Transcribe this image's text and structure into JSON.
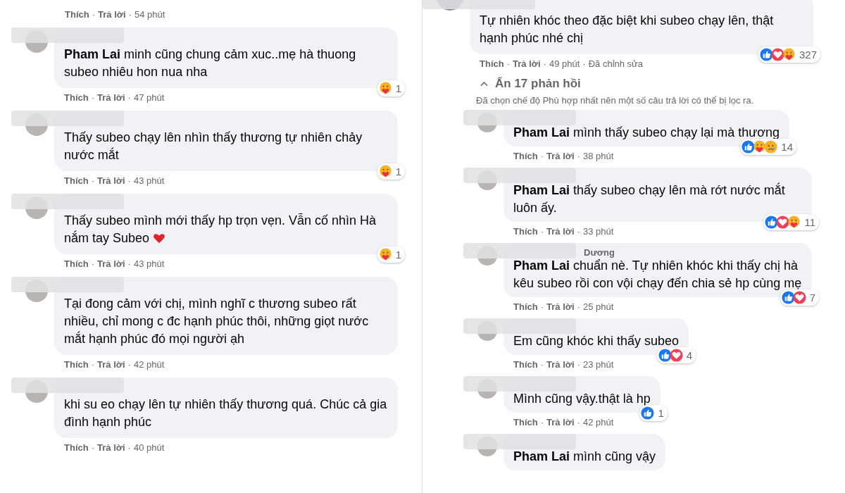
{
  "left_column": {
    "top_meta": {
      "actions": [
        "Thích",
        "Trả lời"
      ],
      "separator": "·",
      "time": "54 phút"
    },
    "comments": [
      {
        "name_blurred": true,
        "text": "**Pham Lai** minh cũng chung cảm xuc..mẹ hà thuong subeo nhiêu hon nua nha",
        "reactions": {
          "icons": [
            {
              "kind": "care"
            }
          ],
          "count": "1"
        },
        "meta": {
          "actions": [
            "Thích",
            "Trả lời"
          ],
          "separator": "·",
          "time": "47 phút"
        }
      },
      {
        "name_blurred": true,
        "text": "Thấy subeo chạy lên nhìn thấy thương tự nhiên chảy nước mắt",
        "reactions": {
          "icons": [
            {
              "kind": "care"
            }
          ],
          "count": "1"
        },
        "meta": {
          "actions": [
            "Thích",
            "Trả lời"
          ],
          "separator": "·",
          "time": "43 phút"
        }
      },
      {
        "name_blurred": true,
        "text": "Thấy subeo mình mới thấy hp trọn vẹn. Vẫn cố nhìn Hà nắm tay Subeo",
        "emoji": {
          "kind": "heart"
        },
        "reactions": {
          "icons": [
            {
              "kind": "care"
            }
          ],
          "count": "1"
        },
        "meta": {
          "actions": [
            "Thích",
            "Trả lời"
          ],
          "separator": "·",
          "time": "43 phút"
        }
      },
      {
        "name_blurred": true,
        "text": "Tại đong cảm với chị, mình nghĩ c thương subeo rất nhiều, chỉ mong c đc hạnh phúc thôi, những giọt nước mắt hạnh phúc đó mọi người ạh",
        "meta": {
          "actions": [
            "Thích",
            "Trả lời"
          ],
          "separator": "·",
          "time": "42 phút"
        }
      },
      {
        "name_blurred": true,
        "text": "khi su eo chạy lên tự nhiên thấy thương quá. Chúc cả gia đình hạnh phúc",
        "meta": {
          "actions": [
            "Thích",
            "Trả lời"
          ],
          "separator": "·",
          "time": "40 phút"
        }
      }
    ]
  },
  "right_column": {
    "comment": {
      "name_blurred": true,
      "text": "Tự nhiên khóc theo đặc biệt khi subeo chạy lên, thật hạnh phúc nhé chị",
      "reactions": {
        "icons": [
          {
            "kind": "like"
          },
          {
            "kind": "love"
          },
          {
            "kind": "care"
          }
        ],
        "count": "327"
      },
      "meta": {
        "actions": [
          "Thích",
          "Trả lời"
        ],
        "separator": "·",
        "time": "49 phút",
        "edited": "Đã chỉnh sửa"
      }
    },
    "replies_toggle": {
      "label": "Ẩn 17 phản hồi",
      "expanded": true
    },
    "filter_note": "Đã chọn chế độ Phù hợp nhất nên một số câu trả lời có thể bị lọc ra.",
    "replies": [
      {
        "name_blurred": true,
        "text": "**Pham Lai** mình thấy subeo chạy lại mà thương",
        "reactions": {
          "icons": [
            {
              "kind": "like"
            },
            {
              "kind": "care"
            },
            {
              "kind": "sad"
            }
          ],
          "count": "14"
        },
        "meta": {
          "actions": [
            "Thích",
            "Trả lời"
          ],
          "separator": "·",
          "time": "38 phút"
        }
      },
      {
        "name_blurred": true,
        "text": "**Pham Lai** thấy subeo chạy lên mà rớt nước mắt luôn ấy.",
        "reactions": {
          "icons": [
            {
              "kind": "like"
            },
            {
              "kind": "love"
            },
            {
              "kind": "care"
            }
          ],
          "count": "11"
        },
        "meta": {
          "actions": [
            "Thích",
            "Trả lời"
          ],
          "separator": "·",
          "time": "33 phút"
        }
      },
      {
        "name_blurred": true,
        "name": "Dương",
        "text": "**Pham Lai** chuẩn nè. Tự nhiên khóc khi thấy chị hà kêu subeo rồi con vội chạy đến chia sẻ hp cùng mẹ",
        "reactions": {
          "icons": [
            {
              "kind": "like"
            },
            {
              "kind": "love"
            }
          ],
          "count": "7"
        },
        "meta": {
          "actions": [
            "Thích",
            "Trả lời"
          ],
          "separator": "·",
          "time": "25 phút"
        }
      },
      {
        "name_blurred": true,
        "text": "Em cũng khóc khi thấy subeo",
        "reactions": {
          "icons": [
            {
              "kind": "like"
            },
            {
              "kind": "love"
            }
          ],
          "count": "4"
        },
        "meta": {
          "actions": [
            "Thích",
            "Trả lời"
          ],
          "separator": "·",
          "time": "23 phút"
        }
      },
      {
        "name_blurred": true,
        "text": "Mình cũng vậy.thật là hp",
        "reactions": {
          "icons": [
            {
              "kind": "like"
            }
          ],
          "count": "1"
        },
        "meta": {
          "actions": [
            "Thích",
            "Trả lời"
          ],
          "separator": "·",
          "time": "42 phút"
        }
      },
      {
        "name_blurred": true,
        "text": "**Pham Lai** mình cũng vậy"
      }
    ]
  }
}
